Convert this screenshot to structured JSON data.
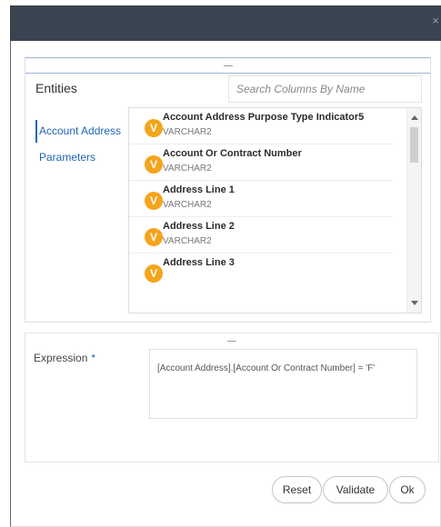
{
  "dialog": {
    "close_glyph": "×"
  },
  "entities": {
    "title": "Entities",
    "search_placeholder": "Search Columns By Name",
    "tabs": [
      {
        "label": "Account Address"
      },
      {
        "label": "Parameters"
      }
    ]
  },
  "columns": [
    {
      "badge": "V",
      "name": "Account Address Purpose Type Indicator5",
      "type": "VARCHAR2"
    },
    {
      "badge": "V",
      "name": "Account Or Contract Number",
      "type": "VARCHAR2"
    },
    {
      "badge": "V",
      "name": "Address Line 1",
      "type": "VARCHAR2"
    },
    {
      "badge": "V",
      "name": "Address Line 2",
      "type": "VARCHAR2"
    },
    {
      "badge": "V",
      "name": "Address Line 3",
      "type": ""
    }
  ],
  "expression": {
    "label": "Expression",
    "required_marker": "*",
    "value": "[Account Address].[Account Or Contract Number] = 'F'"
  },
  "buttons": {
    "reset": "Reset",
    "validate": "Validate",
    "ok": "Ok"
  },
  "colors": {
    "header": "#3a4350",
    "badge": "#f4a51c",
    "link": "#1f66b3"
  },
  "icons": {
    "close": "close-icon",
    "scroll_up": "scroll-up-arrow-icon",
    "scroll_down": "scroll-down-arrow-icon",
    "resize_handle": "resize-handle-icon"
  }
}
